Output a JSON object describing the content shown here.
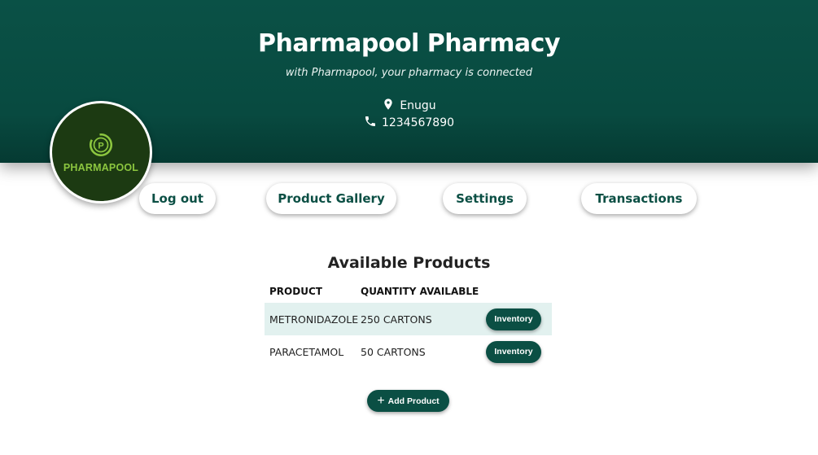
{
  "header": {
    "title": "Pharmapool Pharmacy",
    "tagline": "with Pharmapool, your pharmacy is connected",
    "location": "Enugu",
    "phone": "1234567890",
    "background": "#0a5146"
  },
  "logo": {
    "text": "PHARMAPOOL",
    "letter": "P",
    "color": "#8cc63f"
  },
  "nav": {
    "logout": "Log out",
    "gallery": "Product Gallery",
    "settings": "Settings",
    "transactions": "Transactions"
  },
  "products": {
    "title": "Available Products",
    "headers": {
      "product": "PRODUCT",
      "quantity": "QUANTITY AVAILABLE"
    },
    "rows": [
      {
        "product": "METRONIDAZOLE",
        "quantity": "250 CARTONS",
        "action": "Inventory"
      },
      {
        "product": "PARACETAMOL",
        "quantity": "50 CARTONS",
        "action": "Inventory"
      }
    ],
    "add_label": "Add Product"
  },
  "colors": {
    "accent": "#0b4f44",
    "row_highlight": "#e2f1ef"
  }
}
